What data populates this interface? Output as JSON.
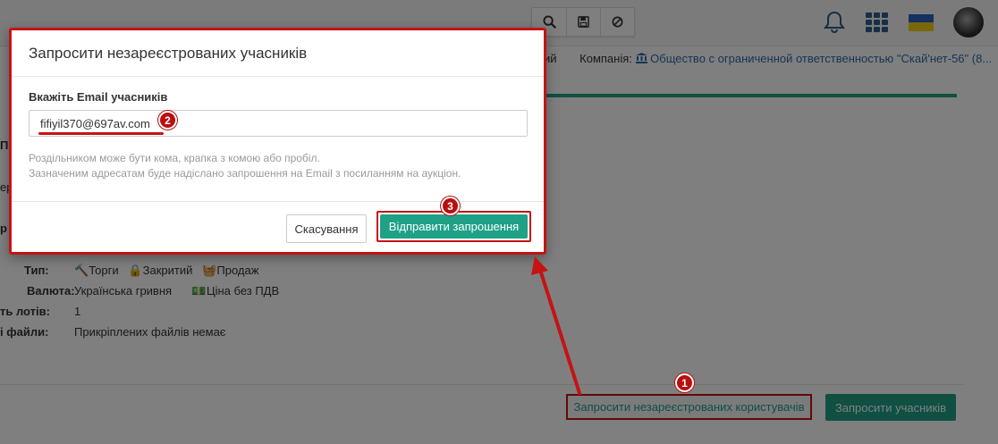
{
  "header": {
    "tools": [
      "search-icon",
      "save-icon",
      "ban-icon"
    ],
    "icons": [
      "bell-icon",
      "apps-grid-icon",
      "ukraine-flag-icon",
      "user-avatar"
    ],
    "colors": {
      "flag_blue": "#2a63c3",
      "flag_yellow": "#f5cf18"
    }
  },
  "company": {
    "truncated_prefix": "ий",
    "label": "Компанія:",
    "icon": "bank-icon",
    "value": "Общество с ограниченной ответственностью \"Скай'нет-56\" (8..."
  },
  "left_edge_fragments": [
    "П",
    "",
    "ер",
    "",
    "р"
  ],
  "details": {
    "type_label": "Тип:",
    "type_values": [
      {
        "icon": "gavel-icon",
        "text": "Торги"
      },
      {
        "icon": "lock-icon",
        "text": "Закритий"
      },
      {
        "icon": "basket-icon",
        "text": "Продаж"
      }
    ],
    "currency_label": "Валюта:",
    "currency_value": "Українська гривня",
    "price_icon": "money-icon",
    "price_value": "Ціна без ПДВ",
    "lots_label": "ть лотів:",
    "lots_value": "1",
    "files_label": "і файли:",
    "files_value": "Прикріплених файлів немає"
  },
  "bottom_buttons": {
    "unregistered": "Запросити незареєстрованих користувачів",
    "invite": "Запросити учасників"
  },
  "modal": {
    "title": "Запросити незареєстрованих учасників",
    "field_label": "Вкажіть Email учасників",
    "email_value": "fifiyil370@697av.com",
    "help_line1": "Роздільником може бути кома, крапка з комою або пробіл.",
    "help_line2": "Зазначеним адресатам буде надіслано запрошення на Email з посиланням на аукціон.",
    "cancel": "Скасування",
    "send": "Відправити запрошення"
  },
  "annotations": {
    "step1": "1",
    "step2": "2",
    "step3": "3",
    "color": "#c41414"
  },
  "theme": {
    "accent": "#1fa187",
    "link": "#2f6aa8"
  }
}
